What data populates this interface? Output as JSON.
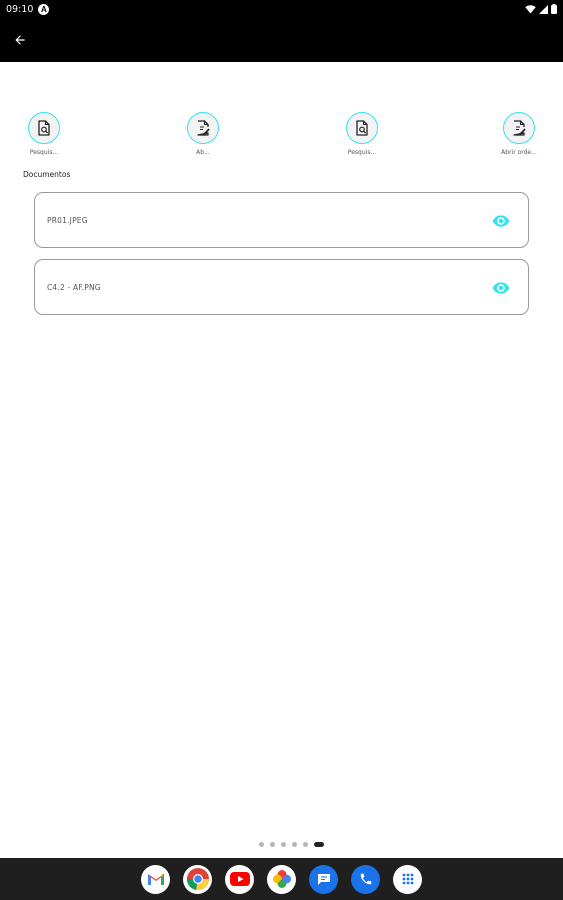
{
  "status_bar": {
    "time": "09:10",
    "notification_letter": "A"
  },
  "app_bar": {
    "back_icon": "arrow-back-icon"
  },
  "actions": [
    {
      "label": "Pesquis...",
      "icon": "document-search-icon"
    },
    {
      "label": "Ab...",
      "icon": "document-edit-icon"
    },
    {
      "label": "Pesquis...",
      "icon": "document-search-icon"
    },
    {
      "label": "Abrir orde...",
      "icon": "document-edit-icon"
    }
  ],
  "documents": {
    "title": "Documentos",
    "items": [
      {
        "name": "PR01.JPEG",
        "action_icon": "eye-icon"
      },
      {
        "name": "C4.2 - AF.PNG",
        "action_icon": "eye-icon"
      }
    ]
  },
  "page_indicator": {
    "count": 6,
    "active_index": 5
  },
  "dock": {
    "apps": [
      "gmail-icon",
      "chrome-icon",
      "youtube-icon",
      "photos-icon",
      "messages-icon",
      "phone-icon",
      "app-drawer-icon"
    ]
  },
  "colors": {
    "accent": "#32e3ef",
    "app_bar": "#000000",
    "card_border": "#9a9a9a",
    "dock": "#1f1f1f"
  }
}
